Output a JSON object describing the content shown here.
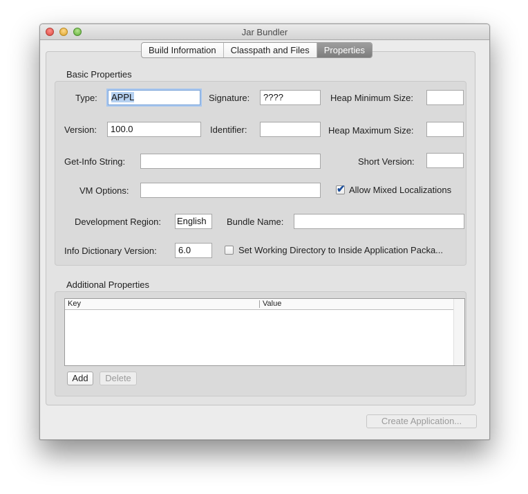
{
  "window": {
    "title": "Jar Bundler"
  },
  "tabs": [
    {
      "label": "Build Information",
      "selected": false
    },
    {
      "label": "Classpath and Files",
      "selected": false
    },
    {
      "label": "Properties",
      "selected": true
    }
  ],
  "basic_properties": {
    "header": "Basic Properties",
    "type": {
      "label": "Type:",
      "value": "APPL"
    },
    "signature": {
      "label": "Signature:",
      "value": "????"
    },
    "heap_min": {
      "label": "Heap Minimum Size:",
      "value": ""
    },
    "version": {
      "label": "Version:",
      "value": "100.0"
    },
    "identifier": {
      "label": "Identifier:",
      "value": ""
    },
    "heap_max": {
      "label": "Heap Maximum Size:",
      "value": ""
    },
    "get_info": {
      "label": "Get-Info String:",
      "value": ""
    },
    "short_version": {
      "label": "Short Version:",
      "value": ""
    },
    "vm_options": {
      "label": "VM Options:",
      "value": ""
    },
    "allow_mixed": {
      "label": "Allow Mixed Localizations",
      "checked": true
    },
    "dev_region": {
      "label": "Development Region:",
      "value": "English"
    },
    "bundle_name": {
      "label": "Bundle Name:",
      "value": ""
    },
    "info_dict": {
      "label": "Info Dictionary Version:",
      "value": "6.0"
    },
    "working_dir": {
      "label": "Set Working Directory to Inside Application Packa...",
      "checked": false
    }
  },
  "additional_properties": {
    "header": "Additional Properties",
    "columns": [
      "Key",
      "Value"
    ],
    "rows": [],
    "add_label": "Add",
    "delete_label": "Delete"
  },
  "footer": {
    "create_label": "Create Application..."
  },
  "colors": {
    "selected_tab": "#8a8a8a",
    "focus_ring": "#a7c6ef",
    "checkmark": "#1d4f9c"
  },
  "icons": {
    "close": "close-light",
    "minimize": "minimize-light",
    "zoom": "zoom-light",
    "check": "checkmark"
  }
}
